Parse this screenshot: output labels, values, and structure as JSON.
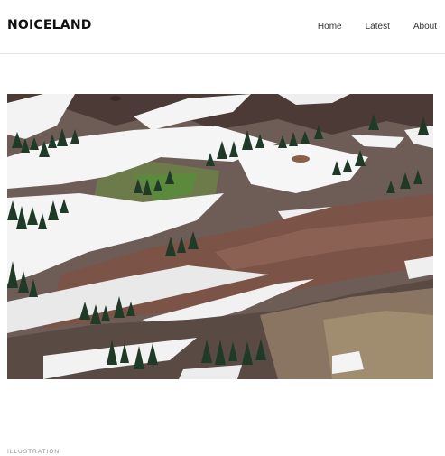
{
  "site": {
    "logo": "NOICELAND"
  },
  "nav": {
    "items": [
      {
        "label": "Home"
      },
      {
        "label": "Latest"
      },
      {
        "label": "About"
      }
    ]
  },
  "hero": {
    "image": "mountain-slopes-snow-patches-photo"
  },
  "post": {
    "category": "ILLUSTRATION"
  },
  "colors": {
    "header_border": "#e2e2e2",
    "text": "#111111",
    "muted": "#8a8a8a"
  }
}
